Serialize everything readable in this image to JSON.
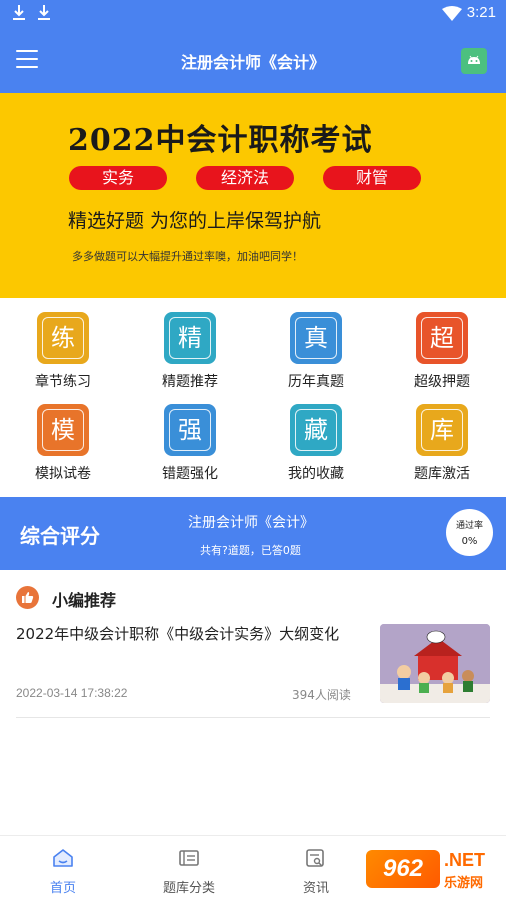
{
  "status_bar": {
    "time": "3:21"
  },
  "header": {
    "title": "注册会计师《会计》"
  },
  "banner": {
    "title": "2022中会计职称考试",
    "tags": [
      "实务",
      "经济法",
      "财管"
    ],
    "subtitle": "精选好题  为您的上岸保驾护航",
    "tagline": "多多做题可以大幅提升通过率噢，加油吧同学！",
    "bg_color": "#fcc800",
    "pill_color": "#e8141c"
  },
  "grid": [
    {
      "char": "练",
      "label": "章节练习",
      "color": "#e8a81c",
      "icon": "practice-icon"
    },
    {
      "char": "精",
      "label": "精题推荐",
      "color": "#2fa8c4",
      "icon": "featured-icon"
    },
    {
      "char": "真",
      "label": "历年真题",
      "color": "#3a8fd8",
      "icon": "past-exam-icon"
    },
    {
      "char": "超",
      "label": "超级押题",
      "color": "#e8542a",
      "icon": "predict-icon"
    },
    {
      "char": "模",
      "label": "模拟试卷",
      "color": "#e8742a",
      "icon": "mock-exam-icon"
    },
    {
      "char": "强",
      "label": "错题强化",
      "color": "#3a8fd8",
      "icon": "mistakes-icon"
    },
    {
      "char": "藏",
      "label": "我的收藏",
      "color": "#2fa8c4",
      "icon": "favorites-icon"
    },
    {
      "char": "库",
      "label": "题库激活",
      "color": "#e8a81c",
      "icon": "activate-icon"
    }
  ],
  "score": {
    "title": "综合评分",
    "course": "注册会计师《会计》",
    "stats": "共有?道题，已答0题",
    "pass_label": "通过率",
    "pass_rate": "0%"
  },
  "recommend": {
    "title": "小编推荐",
    "articles": [
      {
        "title": "2022年中级会计职称《中级会计实务》大纲变化",
        "date": "2022-03-14 17:38:22",
        "reads": "394人阅读"
      }
    ]
  },
  "bottom_nav": [
    {
      "label": "首页",
      "icon": "home-icon",
      "active": true
    },
    {
      "label": "题库分类",
      "icon": "category-icon",
      "active": false
    },
    {
      "label": "资讯",
      "icon": "news-icon",
      "active": false
    }
  ],
  "watermark": {
    "logo": "962",
    "net": ".NET",
    "cn": "乐游网"
  },
  "colors": {
    "primary": "#4a82f0",
    "accent": "#e8743a"
  }
}
